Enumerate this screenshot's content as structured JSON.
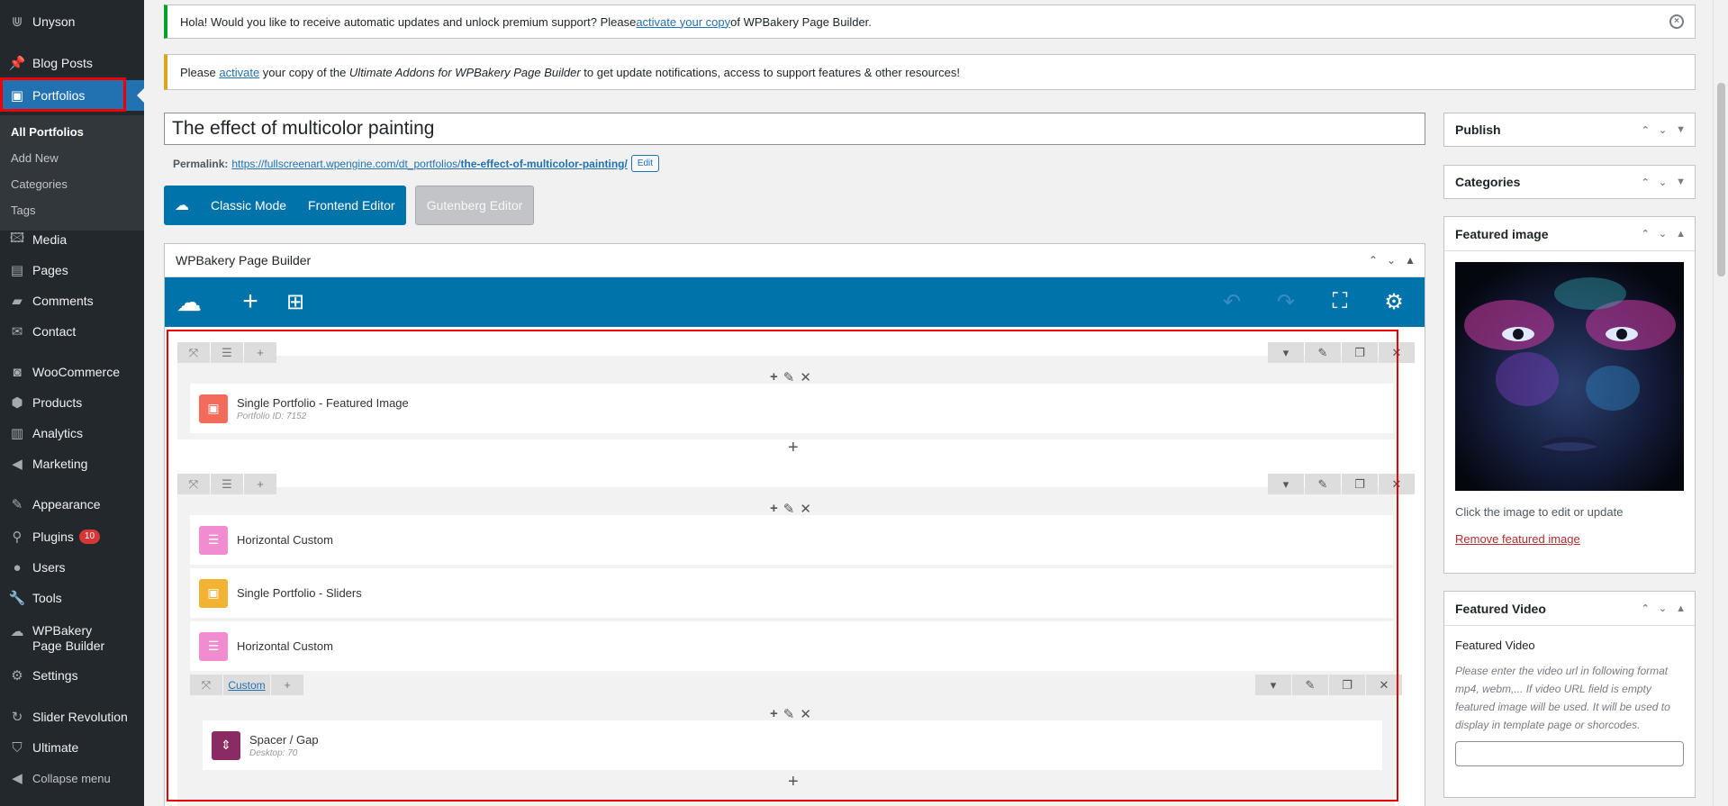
{
  "sidebar": {
    "top_item": "Unyson",
    "items": [
      {
        "label": "Blog Posts",
        "icon": "pin-icon"
      },
      {
        "label": "Portfolios",
        "icon": "image-icon"
      },
      {
        "label": "Media",
        "icon": "media-icon"
      },
      {
        "label": "Pages",
        "icon": "pages-icon"
      },
      {
        "label": "Comments",
        "icon": "comment-icon"
      },
      {
        "label": "Contact",
        "icon": "mail-icon"
      },
      {
        "label": "WooCommerce",
        "icon": "woo-icon"
      },
      {
        "label": "Products",
        "icon": "box-icon"
      },
      {
        "label": "Analytics",
        "icon": "chart-icon"
      },
      {
        "label": "Marketing",
        "icon": "megaphone-icon"
      },
      {
        "label": "Appearance",
        "icon": "brush-icon"
      },
      {
        "label": "Plugins",
        "icon": "plugin-icon",
        "badge": "10"
      },
      {
        "label": "Users",
        "icon": "user-icon"
      },
      {
        "label": "Tools",
        "icon": "wrench-icon"
      },
      {
        "label": "WPBakery Page Builder",
        "icon": "cloud-icon"
      },
      {
        "label": "Settings",
        "icon": "settings-icon"
      },
      {
        "label": "Slider Revolution",
        "icon": "revolution-icon"
      },
      {
        "label": "Ultimate",
        "icon": "shield-icon"
      },
      {
        "label": "Collapse menu",
        "icon": "collapse-icon"
      }
    ],
    "submenu": [
      "All Portfolios",
      "Add New",
      "Categories",
      "Tags"
    ]
  },
  "notices": {
    "update_pre": "Hola! Would you like to receive automatic updates and unlock premium support? Please ",
    "update_link": "activate your copy",
    "update_post": " of WPBakery Page Builder.",
    "addons_pre": "Please ",
    "addons_link": "activate",
    "addons_mid": " your copy of the ",
    "addons_em": "Ultimate Addons for WPBakery Page Builder",
    "addons_post": " to get update notifications, access to support features & other resources!"
  },
  "post": {
    "title": "The effect of multicolor painting",
    "permalink_label": "Permalink:",
    "permalink_base": "https://fullscreenart.wpengine.com/dt_portfolios/",
    "permalink_slug": "the-effect-of-multicolor-painting/",
    "edit_label": "Edit"
  },
  "editor": {
    "classic": "Classic Mode",
    "frontend": "Frontend Editor",
    "gutenberg": "Gutenberg Editor"
  },
  "wpbakery": {
    "title": "WPBakery Page Builder",
    "elements": [
      {
        "title": "Single Portfolio - Featured Image",
        "sub": "Portfolio ID: 7152"
      },
      {
        "title": "Horizontal Custom"
      },
      {
        "title": "Single Portfolio - Sliders"
      },
      {
        "title": "Horizontal Custom"
      },
      {
        "title": "Spacer / Gap",
        "sub": "Desktop: 70"
      }
    ],
    "row_link": "Custom"
  },
  "sidepanel": {
    "publish": "Publish",
    "categories": "Categories",
    "featured_image": "Featured image",
    "fi_caption": "Click the image to edit or update",
    "fi_remove": "Remove featured image",
    "featured_video": "Featured Video",
    "fv_label": "Featured Video",
    "fv_desc": "Please enter the video url in following format mp4, webm,... If video URL field is empty featured image will be used. It will be used to display in template page or shorcodes."
  },
  "colors": {
    "accent": "#0073aa",
    "active": "#2271b1",
    "highlight": "#e00000"
  }
}
